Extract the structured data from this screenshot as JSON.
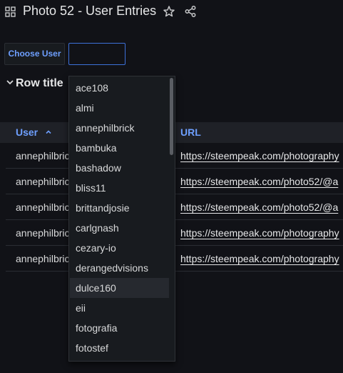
{
  "header": {
    "title": "Photo 52 - User Entries",
    "icons": [
      "grid-icon",
      "star-icon",
      "share-icon"
    ]
  },
  "variable": {
    "label": "Choose User",
    "value": ""
  },
  "row": {
    "title": "Row title",
    "icon": "chevron-down-icon"
  },
  "table": {
    "columns": [
      "User",
      "URL"
    ],
    "sort_icon": "chevron-up-icon",
    "rows": [
      {
        "user": "annephilbrick",
        "url": "https://steempeak.com/photography"
      },
      {
        "user": "annephilbrick",
        "url": "https://steempeak.com/photo52/@a"
      },
      {
        "user": "annephilbrick",
        "url": "https://steempeak.com/photo52/@a"
      },
      {
        "user": "annephilbrick",
        "url": "https://steempeak.com/photography"
      },
      {
        "user": "annephilbrick",
        "url": "https://steempeak.com/photography"
      }
    ]
  },
  "dropdown": {
    "highlighted": "dulce160",
    "options": [
      "ace108",
      "almi",
      "annephilbrick",
      "bambuka",
      "bashadow",
      "bliss11",
      "brittandjosie",
      "carlgnash",
      "cezary-io",
      "derangedvisions",
      "dulce160",
      "eii",
      "fotografia",
      "fotostef"
    ]
  },
  "colors": {
    "background": "#111217",
    "accent": "#6e9fff",
    "input_border": "#3d71d9",
    "header_row": "#1f2127"
  }
}
